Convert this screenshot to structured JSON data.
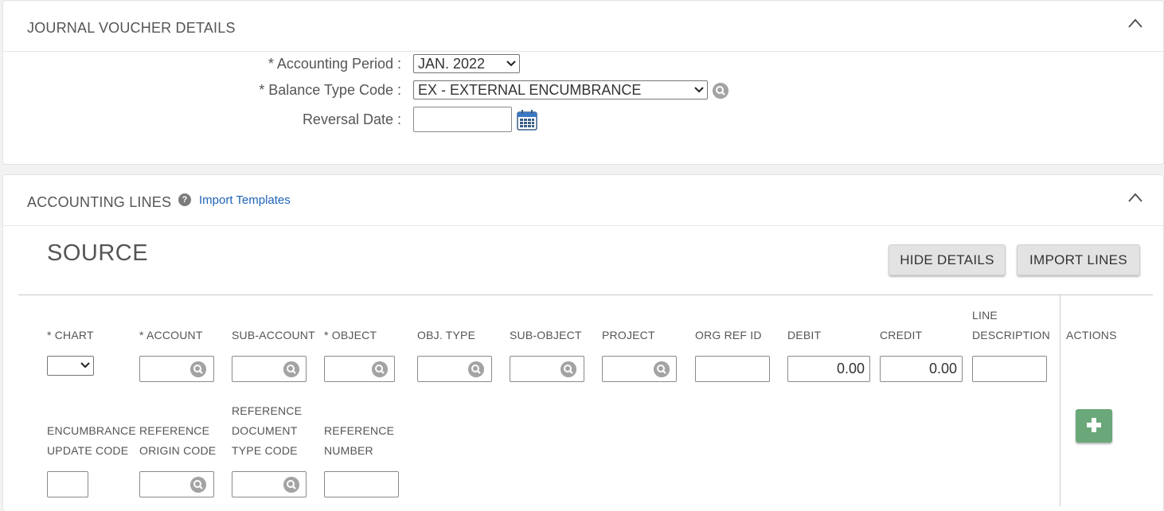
{
  "journal_voucher": {
    "title": "JOURNAL VOUCHER DETAILS",
    "accounting_period_label": "* Accounting Period :",
    "accounting_period_value": "JAN. 2022",
    "balance_type_label": "* Balance Type Code :",
    "balance_type_value": "EX - EXTERNAL ENCUMBRANCE",
    "reversal_date_label": "Reversal Date :",
    "reversal_date_value": ""
  },
  "accounting_lines": {
    "title": "ACCOUNTING LINES",
    "help_icon": "?",
    "import_templates": "Import Templates",
    "section": "SOURCE",
    "hide_details": "HIDE DETAILS",
    "import_lines": "IMPORT LINES",
    "columns": {
      "chart": "* CHART",
      "account": "* ACCOUNT",
      "sub_account": "SUB-ACCOUNT",
      "object": "* OBJECT",
      "obj_type": "OBJ. TYPE",
      "sub_object": "SUB-OBJECT",
      "project": "PROJECT",
      "org_ref_id": "ORG REF ID",
      "debit": "DEBIT",
      "credit": "CREDIT",
      "line_description_1": "LINE",
      "line_description_2": "DESCRIPTION",
      "actions": "ACTIONS",
      "enc_update_1": "ENCUMBRANCE",
      "enc_update_2": "UPDATE CODE",
      "ref_origin_1": "REFERENCE",
      "ref_origin_2": "ORIGIN CODE",
      "ref_doc_type_1": "REFERENCE",
      "ref_doc_type_2": "DOCUMENT",
      "ref_doc_type_3": "TYPE CODE",
      "ref_number_1": "REFERENCE",
      "ref_number_2": "NUMBER"
    },
    "debit_value": "0.00",
    "credit_value": "0.00"
  },
  "colors": {
    "link": "#1d63b7",
    "add_button": "#6aa779",
    "lookup_icon": "#a3a3a3"
  },
  "icons": [
    "chevron-up-icon",
    "search-icon",
    "calendar-icon",
    "help-icon",
    "plus-icon",
    "caret-down-icon"
  ]
}
